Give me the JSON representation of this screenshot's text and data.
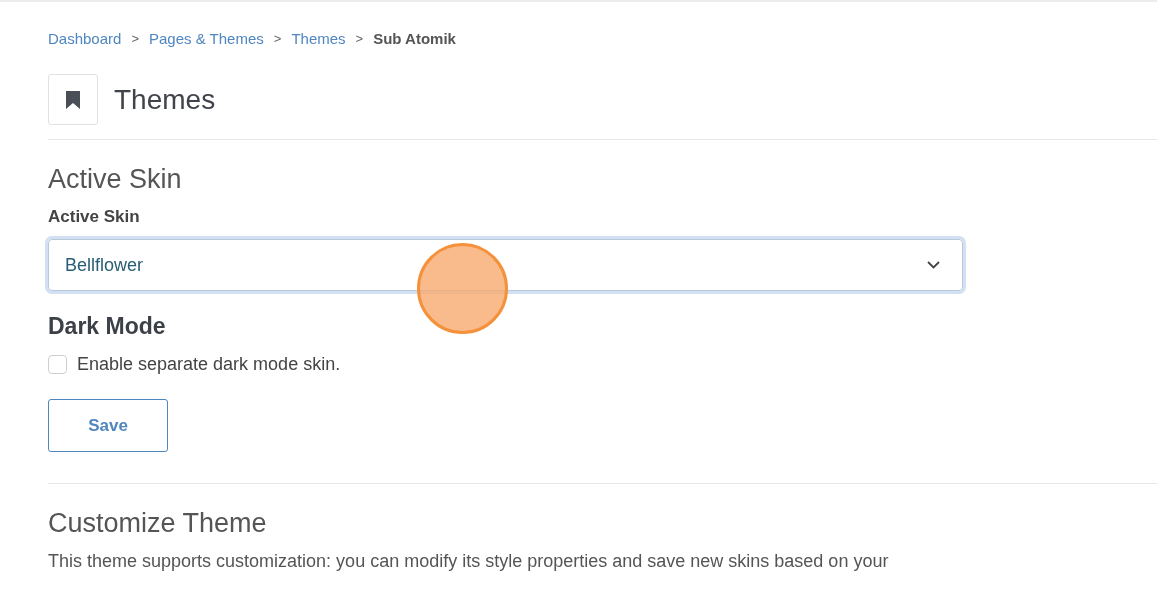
{
  "breadcrumb": [
    {
      "label": "Dashboard",
      "current": false
    },
    {
      "label": "Pages & Themes",
      "current": false
    },
    {
      "label": "Themes",
      "current": false
    },
    {
      "label": "Sub Atomik",
      "current": true
    }
  ],
  "breadcrumb_separator": ">",
  "page_title": "Themes",
  "active_skin": {
    "heading": "Active Skin",
    "label": "Active Skin",
    "value": "Bellflower",
    "focused": true
  },
  "dark_mode": {
    "heading": "Dark Mode",
    "checkbox": {
      "label": "Enable separate dark mode skin.",
      "checked": false
    }
  },
  "save_button": "Save",
  "customize": {
    "heading": "Customize Theme",
    "text": "This theme supports customization: you can modify its style properties and save new skins based on your"
  },
  "click_marker": true
}
